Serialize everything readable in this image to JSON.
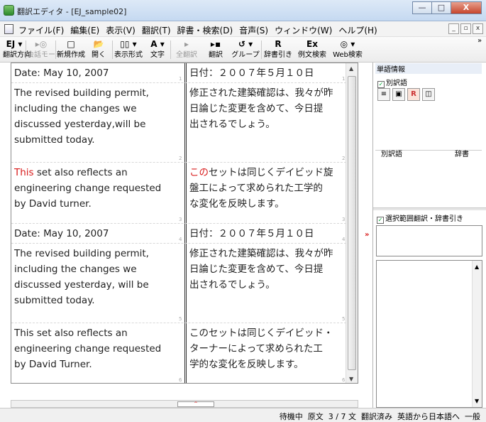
{
  "window": {
    "title": "翻訳エディタ - [EJ_sample02]",
    "min_label": "—",
    "max_label": "□",
    "close_label": "X"
  },
  "menu": {
    "items": [
      "ファイル(F)",
      "編集(E)",
      "表示(V)",
      "翻訳(T)",
      "辞書・検索(D)",
      "音声(S)",
      "ウィンドウ(W)",
      "ヘルプ(H)"
    ],
    "mdi_min": "_",
    "mdi_restore": "▫",
    "mdi_close": "x"
  },
  "toolbar": {
    "buttons": [
      {
        "label": "翻訳方向",
        "icon": "EJ ▾",
        "icon_name": "ej-direction-icon",
        "disabled": false
      },
      {
        "label": "会話モード",
        "icon": "▸◎",
        "icon_name": "conversation-mode-icon",
        "disabled": true
      },
      {
        "label": "新規作成",
        "icon": "□",
        "icon_name": "new-document-icon",
        "disabled": false
      },
      {
        "label": "開く",
        "icon": "📂",
        "icon_name": "open-folder-icon",
        "disabled": false
      },
      {
        "label": "表示形式",
        "icon": "▯▯ ▾",
        "icon_name": "display-format-icon",
        "disabled": false
      },
      {
        "label": "文字",
        "icon": "A ▾",
        "icon_name": "font-icon",
        "disabled": false
      },
      {
        "label": "全翻訳",
        "icon": "▸",
        "icon_name": "translate-all-icon",
        "disabled": true
      },
      {
        "label": "翻訳",
        "icon": "▸▪",
        "icon_name": "translate-icon",
        "disabled": false
      },
      {
        "label": "グループ",
        "icon": "↺ ▾",
        "icon_name": "group-icon",
        "disabled": false
      },
      {
        "label": "辞書引き",
        "icon": "R",
        "icon_name": "dictionary-lookup-icon",
        "disabled": false
      },
      {
        "label": "例文検索",
        "icon": "Ex",
        "icon_name": "example-search-icon",
        "disabled": false
      },
      {
        "label": "Web検索",
        "icon": "◎ ▾",
        "icon_name": "web-search-icon",
        "disabled": false
      }
    ],
    "overflow": "»"
  },
  "segments": [
    {
      "num": "1",
      "src_hl": "",
      "src": "Date: May 10, 2007",
      "tgt_hl": "",
      "tgt": "日付：２００７年５月１０日"
    },
    {
      "num": "2",
      "src_hl": "",
      "src": "The revised building permit,\nincluding the changes we\ndiscussed yesterday,will be\nsubmitted today.",
      "tgt_hl": "",
      "tgt": "修正された建築確認は、我々が昨\n日論じた変更を含めて、今日提\n出されるでしょう。"
    },
    {
      "num": "3",
      "src_hl": "This",
      "src": " set also reflects an\nengineering change requested\nby David turner.",
      "tgt_hl": "この",
      "tgt": "セットは同じくデイビッド旋\n盤工によって求められた工学的\nな変化を反映します。"
    },
    {
      "num": "4",
      "src_hl": "",
      "src": "Date: May 10, 2007",
      "tgt_hl": "",
      "tgt": "日付：２００７年５月１０日"
    },
    {
      "num": "5",
      "src_hl": "",
      "src": "The revised building permit,\nincluding the changes we\ndiscussed yesterday, will be\nsubmitted today.",
      "tgt_hl": "",
      "tgt": "修正された建築確認は、我々が昨\n日論じた変更を含めて、今日提\n出されるでしょう。"
    },
    {
      "num": "6",
      "src_hl": "",
      "src": "This set also reflects an\nengineering change requested\nby David Turner.",
      "tgt_hl": "",
      "tgt": "このセットは同じくデイビッド・\nターナーによって求められた工\n学的な変化を反映します。"
    }
  ],
  "right_pane": {
    "word_info_title": "単語情報",
    "alt_word_checkbox": "別訳語",
    "alt_word_checked": true,
    "dict_col_left": "別訳語",
    "dict_col_right": "辞書",
    "selection_checkbox": "選択範囲翻訳・辞書引き",
    "selection_checked": true,
    "toggle": "»"
  },
  "status": {
    "items": [
      "待機中",
      "原文",
      "3 / 7 文",
      "翻訳済み",
      "英語から日本語へ",
      "一般"
    ]
  }
}
